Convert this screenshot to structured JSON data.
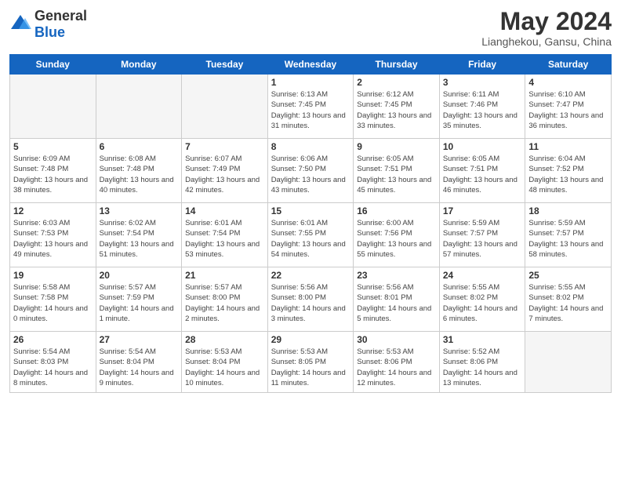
{
  "header": {
    "logo_general": "General",
    "logo_blue": "Blue",
    "month_year": "May 2024",
    "location": "Lianghekou, Gansu, China"
  },
  "days_of_week": [
    "Sunday",
    "Monday",
    "Tuesday",
    "Wednesday",
    "Thursday",
    "Friday",
    "Saturday"
  ],
  "weeks": [
    [
      {
        "day": "",
        "info": ""
      },
      {
        "day": "",
        "info": ""
      },
      {
        "day": "",
        "info": ""
      },
      {
        "day": "1",
        "info": "Sunrise: 6:13 AM\nSunset: 7:45 PM\nDaylight: 13 hours\nand 31 minutes."
      },
      {
        "day": "2",
        "info": "Sunrise: 6:12 AM\nSunset: 7:45 PM\nDaylight: 13 hours\nand 33 minutes."
      },
      {
        "day": "3",
        "info": "Sunrise: 6:11 AM\nSunset: 7:46 PM\nDaylight: 13 hours\nand 35 minutes."
      },
      {
        "day": "4",
        "info": "Sunrise: 6:10 AM\nSunset: 7:47 PM\nDaylight: 13 hours\nand 36 minutes."
      }
    ],
    [
      {
        "day": "5",
        "info": "Sunrise: 6:09 AM\nSunset: 7:48 PM\nDaylight: 13 hours\nand 38 minutes."
      },
      {
        "day": "6",
        "info": "Sunrise: 6:08 AM\nSunset: 7:48 PM\nDaylight: 13 hours\nand 40 minutes."
      },
      {
        "day": "7",
        "info": "Sunrise: 6:07 AM\nSunset: 7:49 PM\nDaylight: 13 hours\nand 42 minutes."
      },
      {
        "day": "8",
        "info": "Sunrise: 6:06 AM\nSunset: 7:50 PM\nDaylight: 13 hours\nand 43 minutes."
      },
      {
        "day": "9",
        "info": "Sunrise: 6:05 AM\nSunset: 7:51 PM\nDaylight: 13 hours\nand 45 minutes."
      },
      {
        "day": "10",
        "info": "Sunrise: 6:05 AM\nSunset: 7:51 PM\nDaylight: 13 hours\nand 46 minutes."
      },
      {
        "day": "11",
        "info": "Sunrise: 6:04 AM\nSunset: 7:52 PM\nDaylight: 13 hours\nand 48 minutes."
      }
    ],
    [
      {
        "day": "12",
        "info": "Sunrise: 6:03 AM\nSunset: 7:53 PM\nDaylight: 13 hours\nand 49 minutes."
      },
      {
        "day": "13",
        "info": "Sunrise: 6:02 AM\nSunset: 7:54 PM\nDaylight: 13 hours\nand 51 minutes."
      },
      {
        "day": "14",
        "info": "Sunrise: 6:01 AM\nSunset: 7:54 PM\nDaylight: 13 hours\nand 53 minutes."
      },
      {
        "day": "15",
        "info": "Sunrise: 6:01 AM\nSunset: 7:55 PM\nDaylight: 13 hours\nand 54 minutes."
      },
      {
        "day": "16",
        "info": "Sunrise: 6:00 AM\nSunset: 7:56 PM\nDaylight: 13 hours\nand 55 minutes."
      },
      {
        "day": "17",
        "info": "Sunrise: 5:59 AM\nSunset: 7:57 PM\nDaylight: 13 hours\nand 57 minutes."
      },
      {
        "day": "18",
        "info": "Sunrise: 5:59 AM\nSunset: 7:57 PM\nDaylight: 13 hours\nand 58 minutes."
      }
    ],
    [
      {
        "day": "19",
        "info": "Sunrise: 5:58 AM\nSunset: 7:58 PM\nDaylight: 14 hours\nand 0 minutes."
      },
      {
        "day": "20",
        "info": "Sunrise: 5:57 AM\nSunset: 7:59 PM\nDaylight: 14 hours\nand 1 minute."
      },
      {
        "day": "21",
        "info": "Sunrise: 5:57 AM\nSunset: 8:00 PM\nDaylight: 14 hours\nand 2 minutes."
      },
      {
        "day": "22",
        "info": "Sunrise: 5:56 AM\nSunset: 8:00 PM\nDaylight: 14 hours\nand 3 minutes."
      },
      {
        "day": "23",
        "info": "Sunrise: 5:56 AM\nSunset: 8:01 PM\nDaylight: 14 hours\nand 5 minutes."
      },
      {
        "day": "24",
        "info": "Sunrise: 5:55 AM\nSunset: 8:02 PM\nDaylight: 14 hours\nand 6 minutes."
      },
      {
        "day": "25",
        "info": "Sunrise: 5:55 AM\nSunset: 8:02 PM\nDaylight: 14 hours\nand 7 minutes."
      }
    ],
    [
      {
        "day": "26",
        "info": "Sunrise: 5:54 AM\nSunset: 8:03 PM\nDaylight: 14 hours\nand 8 minutes."
      },
      {
        "day": "27",
        "info": "Sunrise: 5:54 AM\nSunset: 8:04 PM\nDaylight: 14 hours\nand 9 minutes."
      },
      {
        "day": "28",
        "info": "Sunrise: 5:53 AM\nSunset: 8:04 PM\nDaylight: 14 hours\nand 10 minutes."
      },
      {
        "day": "29",
        "info": "Sunrise: 5:53 AM\nSunset: 8:05 PM\nDaylight: 14 hours\nand 11 minutes."
      },
      {
        "day": "30",
        "info": "Sunrise: 5:53 AM\nSunset: 8:06 PM\nDaylight: 14 hours\nand 12 minutes."
      },
      {
        "day": "31",
        "info": "Sunrise: 5:52 AM\nSunset: 8:06 PM\nDaylight: 14 hours\nand 13 minutes."
      },
      {
        "day": "",
        "info": ""
      }
    ]
  ]
}
